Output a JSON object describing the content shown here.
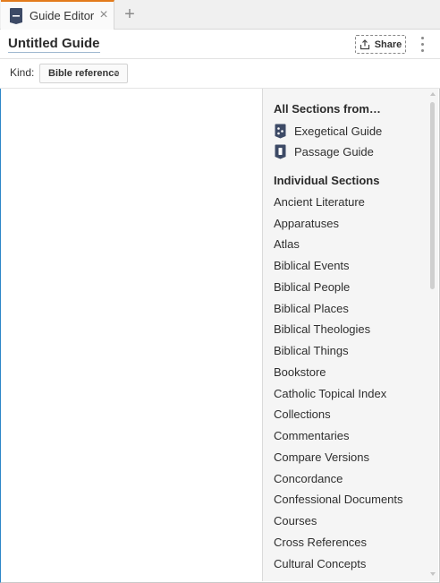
{
  "tab": {
    "title": "Guide Editor",
    "icon": "guide-document-icon",
    "close_label": "×",
    "new_tab_label": "+"
  },
  "header": {
    "title": "Untitled Guide",
    "share_label": "Share",
    "share_icon": "share-icon",
    "more_icon": "more-vertical-icon"
  },
  "kind": {
    "label": "Kind:",
    "selected": "Bible reference"
  },
  "panel": {
    "all_sections_heading": "All Sections from…",
    "guides": [
      {
        "label": "Exegetical Guide",
        "icon": "exegetical-guide-icon"
      },
      {
        "label": "Passage Guide",
        "icon": "passage-guide-icon"
      }
    ],
    "individual_heading": "Individual Sections",
    "sections": [
      "Ancient Literature",
      "Apparatuses",
      "Atlas",
      "Biblical Events",
      "Biblical People",
      "Biblical Places",
      "Biblical Theologies",
      "Biblical Things",
      "Bookstore",
      "Catholic Topical Index",
      "Collections",
      "Commentaries",
      "Compare Versions",
      "Concordance",
      "Confessional Documents",
      "Courses",
      "Cross References",
      "Cultural Concepts"
    ]
  },
  "colors": {
    "tab_accent": "#e37b1c",
    "icon_navy": "#3d4a66",
    "panel_bg": "#f5f5f5"
  }
}
